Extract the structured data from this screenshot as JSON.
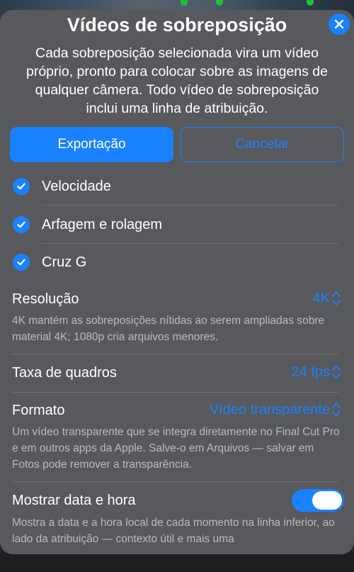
{
  "header": {
    "title": "Vídeos de sobreposição",
    "subtitle": "Cada sobreposição selecionada vira um vídeo próprio, pronto para colocar sobre as imagens de qualquer câmera. Todo vídeo de sobreposição inclui uma linha de atribuição."
  },
  "actions": {
    "export_label": "Exportação",
    "cancel_label": "Cancelar"
  },
  "overlays": [
    {
      "label": "Velocidade",
      "checked": true
    },
    {
      "label": "Arfagem e rolagem",
      "checked": true
    },
    {
      "label": "Cruz G",
      "checked": true
    }
  ],
  "resolution": {
    "label": "Resolução",
    "value": "4K",
    "description": "4K mantém as sobreposições nítidas ao serem ampliadas sobre material 4K; 1080p cria arquivos menores."
  },
  "frame_rate": {
    "label": "Taxa de quadros",
    "value": "24 fps"
  },
  "format": {
    "label": "Formato",
    "value": "Vídeo transparente",
    "description": "Um vídeo transparente que se integra diretamente no Final Cut Pro e em outros apps da Apple. Salve-o em Arquivos — salvar em Fotos pode remover a transparência."
  },
  "show_datetime": {
    "label": "Mostrar data e hora",
    "enabled": true,
    "description": "Mostra a data e a hora local de cada momento na linha inferior, ao lado da atribuição — contexto útil e mais uma"
  },
  "icons": {
    "close": "close-icon",
    "check": "checkmark-icon",
    "updown": "chevron-up-down-icon"
  },
  "colors": {
    "accent": "#1a82ff",
    "sheet": "#58595c",
    "secondary_text": "#b9babd"
  }
}
